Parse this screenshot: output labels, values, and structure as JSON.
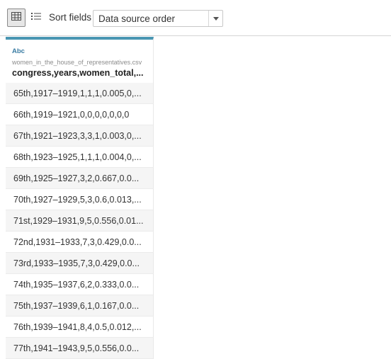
{
  "toolbar": {
    "grid_view_icon": "grid-icon",
    "list_view_icon": "list-icon",
    "sort_label": "Sort fields",
    "sort_value": "Data source order"
  },
  "column": {
    "type_label": "Abc",
    "source": "women_in_the_house_of_representatives.csv",
    "name": "congress,years,women_total,..."
  },
  "rows": [
    "65th,1917–1919,1,1,1,0.005,0,...",
    "66th,1919–1921,0,0,0,0,0,0,0",
    "67th,1921–1923,3,3,1,0.003,0,...",
    "68th,1923–1925,1,1,1,0.004,0,...",
    "69th,1925–1927,3,2,0.667,0.0...",
    "70th,1927–1929,5,3,0.6,0.013,...",
    "71st,1929–1931,9,5,0.556,0.01...",
    "72nd,1931–1933,7,3,0.429,0.0...",
    "73rd,1933–1935,7,3,0.429,0.0...",
    "74th,1935–1937,6,2,0.333,0.0...",
    "75th,1937–1939,6,1,0.167,0.0...",
    "76th,1939–1941,8,4,0.5,0.012,...",
    "77th,1941–1943,9,5,0.556,0.0..."
  ],
  "colors": {
    "header_accent": "#4996b2",
    "type_label": "#3a7ca3"
  }
}
